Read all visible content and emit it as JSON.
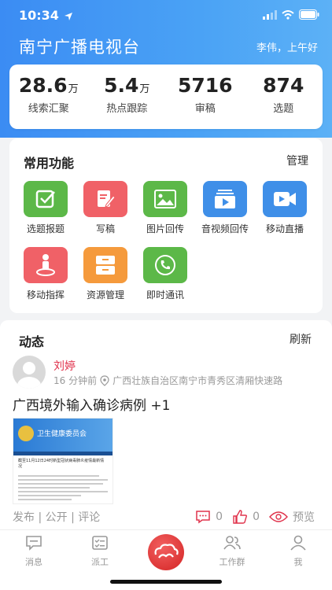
{
  "status_bar": {
    "time": "10:34"
  },
  "header": {
    "title": "南宁广播电视台",
    "greeting": "李伟，上午好"
  },
  "stats": [
    {
      "value": "28.6",
      "unit": "万",
      "label": "线索汇聚"
    },
    {
      "value": "5.4",
      "unit": "万",
      "label": "热点跟踪"
    },
    {
      "value": "5716",
      "unit": "",
      "label": "审稿"
    },
    {
      "value": "874",
      "unit": "",
      "label": "选题"
    }
  ],
  "functions": {
    "title": "常用功能",
    "manage_label": "管理",
    "items": [
      {
        "label": "选题报题",
        "icon": "checkbox-icon",
        "color": "#5cb848"
      },
      {
        "label": "写稿",
        "icon": "edit-icon",
        "color": "#f06167"
      },
      {
        "label": "图片回传",
        "icon": "image-icon",
        "color": "#5cb848"
      },
      {
        "label": "音视频回传",
        "icon": "media-stack-icon",
        "color": "#3f8fe8"
      },
      {
        "label": "移动直播",
        "icon": "video-camera-icon",
        "color": "#3f8fe8"
      },
      {
        "label": "移动指挥",
        "icon": "person-pin-icon",
        "color": "#f06167"
      },
      {
        "label": "资源管理",
        "icon": "cabinet-icon",
        "color": "#f59a3c"
      },
      {
        "label": "即时通讯",
        "icon": "phone-icon",
        "color": "#5cb848"
      }
    ]
  },
  "feed": {
    "title": "动态",
    "refresh_label": "刷新",
    "post": {
      "author": "刘婷",
      "time": "16 分钟前",
      "location": "广西壮族自治区南宁市青秀区清厢快速路",
      "text": "广西境外输入确诊病例 +1",
      "image_banner": "卫生健康委员会",
      "image_headline": "截至11月12日24时新型冠状病毒肺炎疫情最新情况",
      "actions": "发布 | 公开 | 评论",
      "comments": "0",
      "likes": "0",
      "preview_label": "预览"
    }
  },
  "tabbar": {
    "tabs": [
      {
        "label": "消息",
        "icon": "message-icon"
      },
      {
        "label": "派工",
        "icon": "task-list-icon"
      },
      {
        "label": "工作群",
        "icon": "group-icon"
      },
      {
        "label": "我",
        "icon": "user-icon"
      }
    ]
  }
}
